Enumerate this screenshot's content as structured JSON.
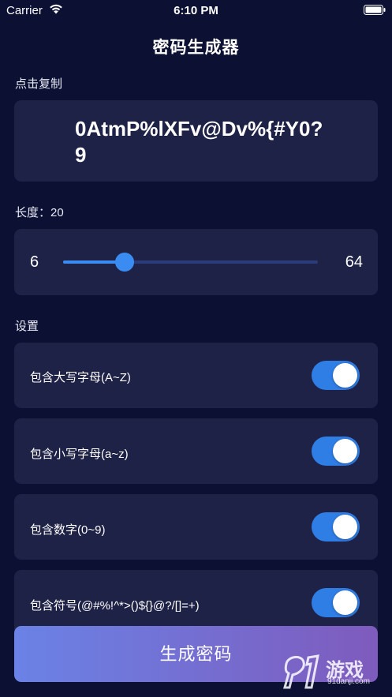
{
  "status_bar": {
    "carrier": "Carrier",
    "time": "6:10 PM"
  },
  "nav": {
    "title": "密码生成器"
  },
  "copy_section": {
    "label": "点击复制",
    "password": "0AtmP%lXFv@Dv%{#Y0?9"
  },
  "length_section": {
    "label": "长度：20",
    "min": "6",
    "max": "64",
    "value": 20,
    "range": [
      6,
      64
    ]
  },
  "settings": {
    "label": "设置",
    "options": [
      {
        "label": "包含大写字母(A~Z)",
        "enabled": true
      },
      {
        "label": "包含小写字母(a~z)",
        "enabled": true
      },
      {
        "label": "包含数字(0~9)",
        "enabled": true
      },
      {
        "label": "包含符号(@#%!^*>()${}@?/[]=+)",
        "enabled": true
      }
    ]
  },
  "generate_button": {
    "label": "生成密码"
  },
  "watermark": {
    "brand": "游戏",
    "site": "91danji.com"
  },
  "colors": {
    "background": "#0c1033",
    "card": "#1f2247",
    "accent": "#3b8cf2",
    "button_gradient_start": "#6b82e6",
    "button_gradient_end": "#7e5bbd"
  }
}
